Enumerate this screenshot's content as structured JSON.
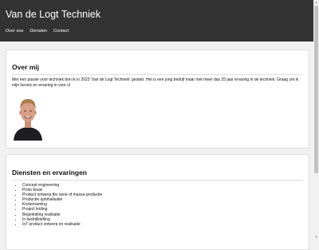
{
  "header": {
    "title": "Van de Logt Techniek",
    "nav": [
      "Over ons",
      "Diensten",
      "Contact"
    ]
  },
  "about": {
    "heading": "Over mij",
    "text": "Met een passie voor techniek ben ik in 2023 'Van de Logt Techniek' gestart. Het is een jong bedrijf maar met meer das 25 jaar ervaring in de techniek. Graag zet ik mijn kennis en ervaring in voor u!",
    "avatar_icon": "portrait-photo"
  },
  "services": {
    "heading": "Diensten en ervaringen",
    "items": [
      "Concept engineering",
      "Proto bouw",
      "Product ontwerp tbv serie of massa productie",
      "Productie optimalisatie",
      "Kostenraming",
      "Project leiding",
      "Begeleiding realisatie",
      "In bedrijfstelling",
      "IoT product ontwerp en realisatie"
    ]
  },
  "colors": {
    "header_bg": "#333333",
    "page_bg": "#f1f1f1",
    "card_bg": "#ffffff"
  }
}
